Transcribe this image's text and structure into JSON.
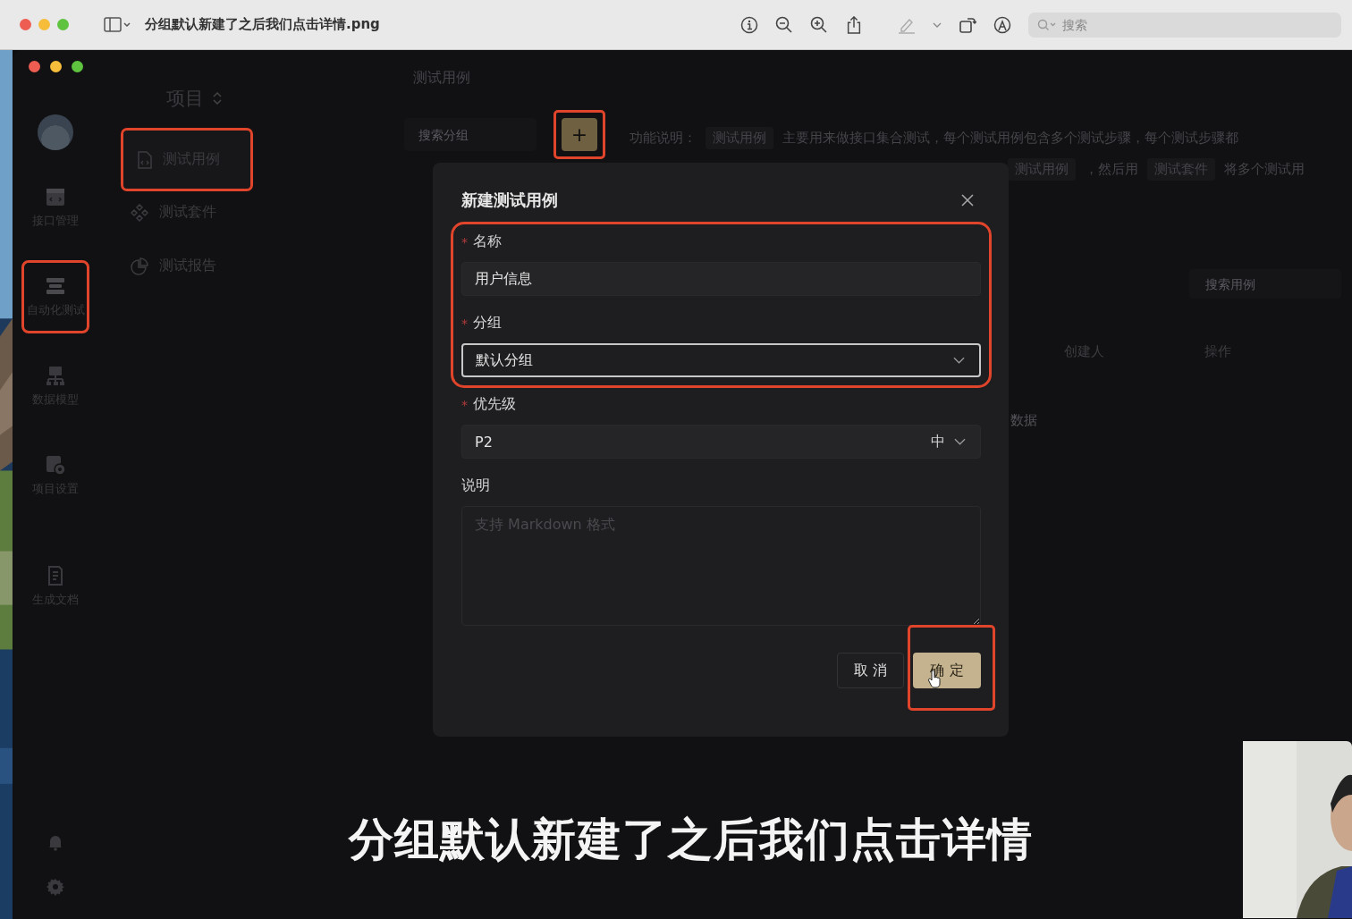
{
  "window": {
    "title": "分组默认新建了之后我们点击详情.png",
    "search": {
      "placeholder": "搜索"
    }
  },
  "rail": {
    "items": [
      {
        "label": "接口管理",
        "highlighted": false
      },
      {
        "label": "自动化测试",
        "highlighted": true
      },
      {
        "label": "数据模型",
        "highlighted": false
      },
      {
        "label": "项目设置",
        "highlighted": false
      },
      {
        "label": "生成文档",
        "highlighted": false
      }
    ]
  },
  "menu": {
    "header": "项目",
    "items": [
      {
        "label": "测试用例",
        "selected": true,
        "highlighted": true
      },
      {
        "label": "测试套件",
        "selected": false,
        "highlighted": false
      },
      {
        "label": "测试报告",
        "selected": false,
        "highlighted": false
      }
    ]
  },
  "main": {
    "title": "测试用例",
    "group_search": {
      "placeholder": "搜索分组"
    },
    "add_button": {
      "label": "+",
      "highlighted": true
    },
    "description": {
      "label": "功能说明：",
      "line_1": [
        {
          "kind": "tag",
          "text": "测试用例"
        },
        {
          "kind": "text",
          "text": "主要用来做接口集合测试，每个测试用例包含多个测试步骤，每个测试步骤都"
        }
      ],
      "line_2": [
        {
          "kind": "tag",
          "text": "测试用例"
        },
        {
          "kind": "text",
          "text": "，然后用"
        },
        {
          "kind": "tag",
          "text": "测试套件"
        },
        {
          "kind": "text",
          "text": "将多个测试用"
        }
      ]
    },
    "case_search": {
      "placeholder": "搜索用例"
    },
    "table": {
      "columns": [
        "创建人",
        "操作"
      ]
    },
    "empty_text": "数据"
  },
  "dialog": {
    "title": "新建测试用例",
    "field_groups": [
      {
        "highlighted": true,
        "fields": [
          {
            "kind": "input",
            "label": "名称",
            "required_mark": "*",
            "value": "用户信息",
            "focused": false
          },
          {
            "kind": "select",
            "label": "分组",
            "required_mark": "*",
            "value": "默认分组",
            "focused": true
          }
        ]
      },
      {
        "highlighted": false,
        "fields": [
          {
            "kind": "select",
            "label": "优先级",
            "required_mark": "*",
            "value": "P2",
            "suffix": "中",
            "focused": false
          },
          {
            "kind": "textarea",
            "label": "说明",
            "placeholder": "支持 Markdown 格式",
            "focused": false
          }
        ]
      }
    ],
    "buttons": [
      {
        "kind": "secondary",
        "label": "取 消",
        "highlighted": false
      },
      {
        "kind": "primary",
        "label": "确 定",
        "highlighted": true
      }
    ]
  },
  "caption": "分组默认新建了之后我们点击详情"
}
